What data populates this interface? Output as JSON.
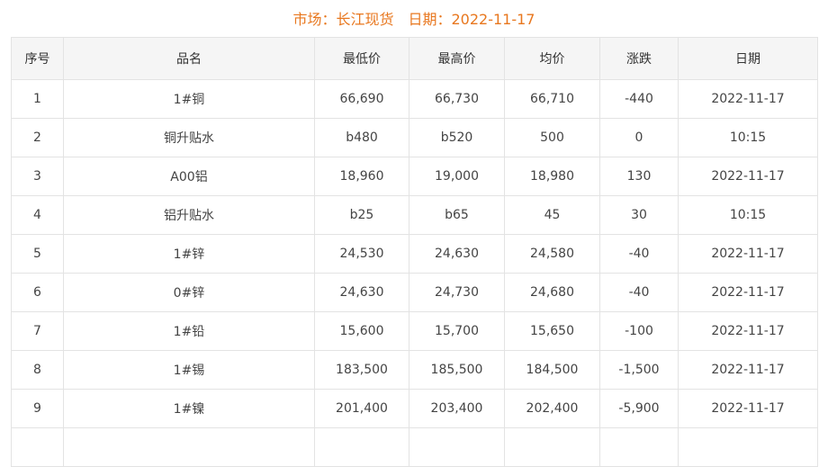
{
  "title": {
    "market_label": "市场：长江现货",
    "date_label": "日期：2022-11-17"
  },
  "colors": {
    "title": "#e8771e",
    "down": "#0a8a1e",
    "up": "#d0021b",
    "flat": "#aaaaaa"
  },
  "table": {
    "headers": [
      "序号",
      "品名",
      "最低价",
      "最高价",
      "均价",
      "涨跌",
      "日期"
    ],
    "rows": [
      {
        "no": "1",
        "name": "1#铜",
        "low": "66,690",
        "high": "66,730",
        "avg": "66,710",
        "change": "-440",
        "dir": "down",
        "date": "2022-11-17"
      },
      {
        "no": "2",
        "name": "铜升贴水",
        "low": "b480",
        "high": "b520",
        "avg": "500",
        "change": "0",
        "dir": "flat",
        "date": "10:15"
      },
      {
        "no": "3",
        "name": "A00铝",
        "low": "18,960",
        "high": "19,000",
        "avg": "18,980",
        "change": "130",
        "dir": "up",
        "date": "2022-11-17"
      },
      {
        "no": "4",
        "name": "铝升贴水",
        "low": "b25",
        "high": "b65",
        "avg": "45",
        "change": "30",
        "dir": "up",
        "date": "10:15"
      },
      {
        "no": "5",
        "name": "1#锌",
        "low": "24,530",
        "high": "24,630",
        "avg": "24,580",
        "change": "-40",
        "dir": "down",
        "date": "2022-11-17"
      },
      {
        "no": "6",
        "name": "0#锌",
        "low": "24,630",
        "high": "24,730",
        "avg": "24,680",
        "change": "-40",
        "dir": "down",
        "date": "2022-11-17"
      },
      {
        "no": "7",
        "name": "1#铅",
        "low": "15,600",
        "high": "15,700",
        "avg": "15,650",
        "change": "-100",
        "dir": "down",
        "date": "2022-11-17"
      },
      {
        "no": "8",
        "name": "1#锡",
        "low": "183,500",
        "high": "185,500",
        "avg": "184,500",
        "change": "-1,500",
        "dir": "down",
        "date": "2022-11-17"
      },
      {
        "no": "9",
        "name": "1#镍",
        "low": "201,400",
        "high": "203,400",
        "avg": "202,400",
        "change": "-5,900",
        "dir": "down",
        "date": "2022-11-17"
      },
      {
        "no": "",
        "name": "",
        "low": "",
        "high": "",
        "avg": "",
        "change": "",
        "dir": "flat",
        "date": ""
      }
    ]
  }
}
